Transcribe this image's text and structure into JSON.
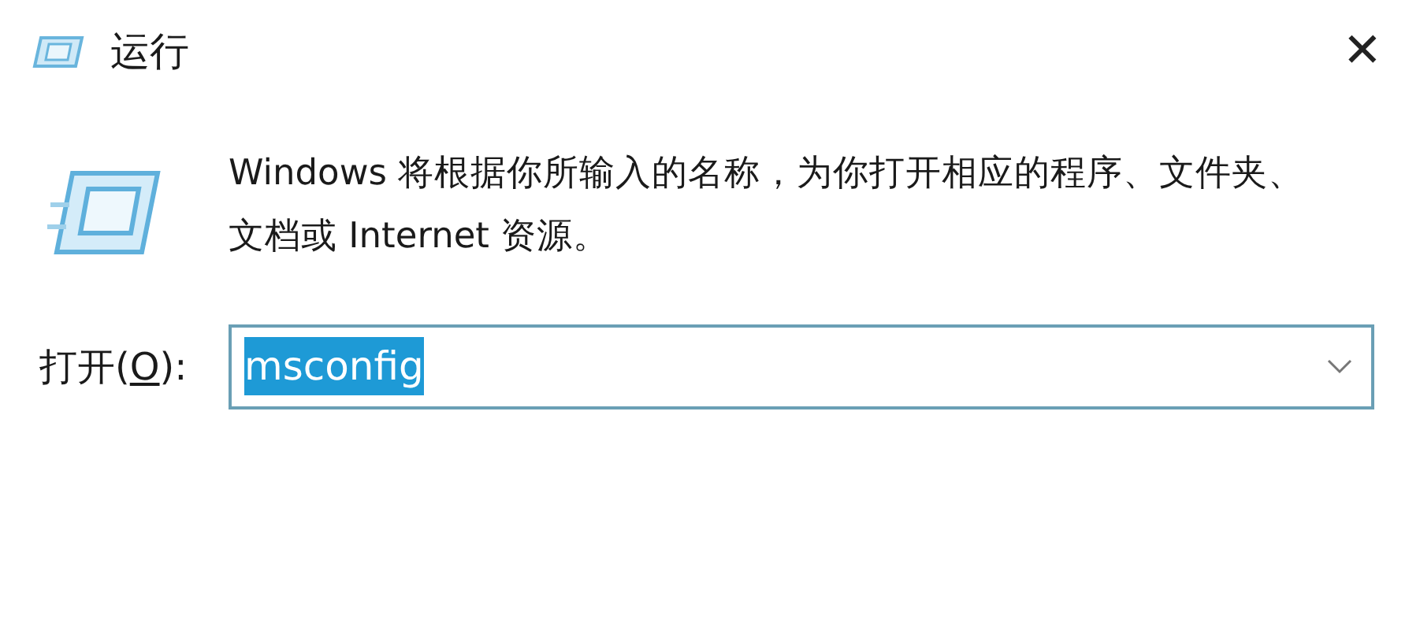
{
  "window": {
    "title": "运行",
    "close_glyph": "✕"
  },
  "description": "Windows 将根据你所输入的名称，为你打开相应的程序、文件夹、文档或 Internet 资源。",
  "open_field": {
    "label_before": "打开(",
    "access_key": "O",
    "label_after": "):",
    "value": "msconfig",
    "text_selected": true
  }
}
